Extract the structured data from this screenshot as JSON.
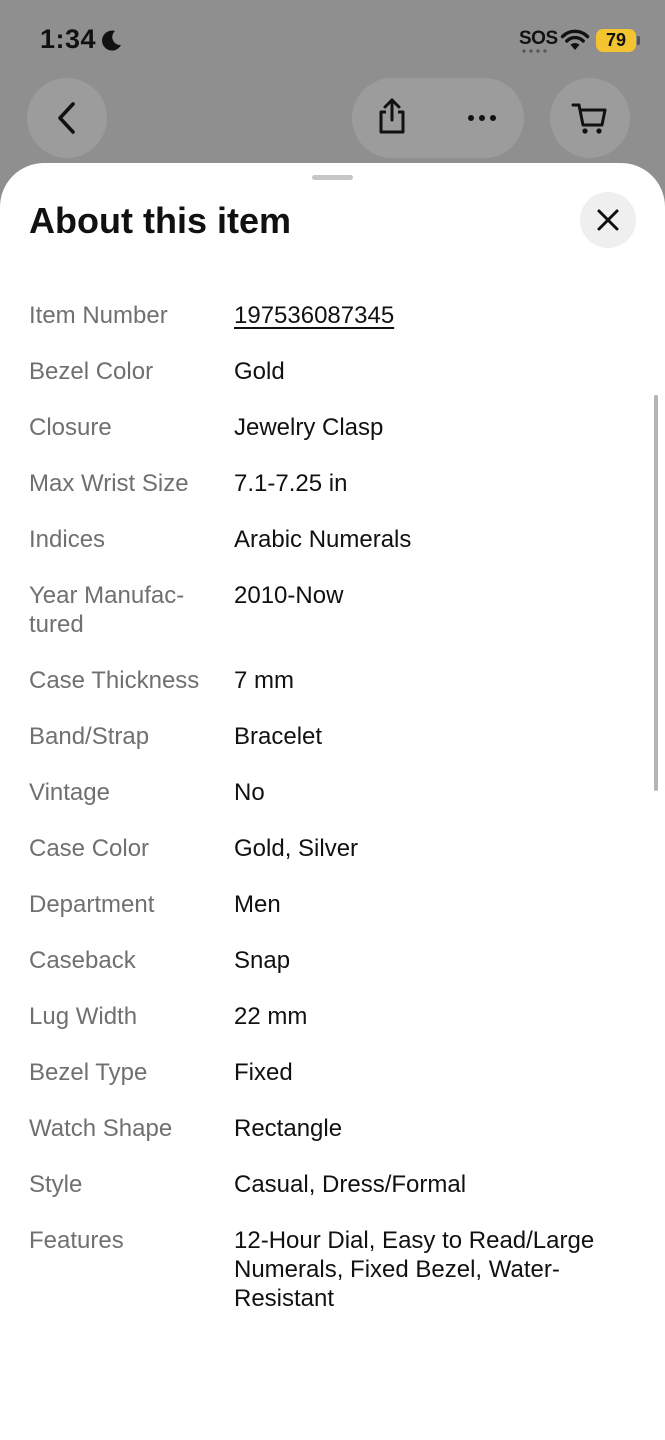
{
  "status_bar": {
    "time": "1:34",
    "sos": "SOS",
    "battery": "79",
    "battery_color": "#f4c430"
  },
  "nav": {
    "back_icon": "chevron-left-icon",
    "share_icon": "share-icon",
    "more_icon": "ellipsis-icon",
    "cart_icon": "cart-icon"
  },
  "sheet": {
    "title": "About this item",
    "close_icon": "close-icon"
  },
  "specs": [
    {
      "label": "Item Number",
      "value": "197536087345"
    },
    {
      "label": "Bezel Color",
      "value": "Gold"
    },
    {
      "label": "Closure",
      "value": "Jewelry Clasp"
    },
    {
      "label": "Max Wrist Size",
      "value": "7.1-7.25 in"
    },
    {
      "label": "Indices",
      "value": "Arabic Numerals"
    },
    {
      "label": "Year Manufac-\ntured",
      "value": "2010-Now"
    },
    {
      "label": "Case Thickness",
      "value": "7 mm"
    },
    {
      "label": "Band/Strap",
      "value": "Bracelet"
    },
    {
      "label": "Vintage",
      "value": "No"
    },
    {
      "label": "Case Color",
      "value": "Gold, Silver"
    },
    {
      "label": "Department",
      "value": "Men"
    },
    {
      "label": "Caseback",
      "value": "Snap"
    },
    {
      "label": "Lug Width",
      "value": "22 mm"
    },
    {
      "label": "Bezel Type",
      "value": "Fixed"
    },
    {
      "label": "Watch Shape",
      "value": "Rectangle"
    },
    {
      "label": "Style",
      "value": "Casual, Dress/Formal"
    },
    {
      "label": "Features",
      "value": "12-Hour Dial, Easy to Read/Large Numerals, Fixed Bezel, Water-Resistant"
    }
  ]
}
